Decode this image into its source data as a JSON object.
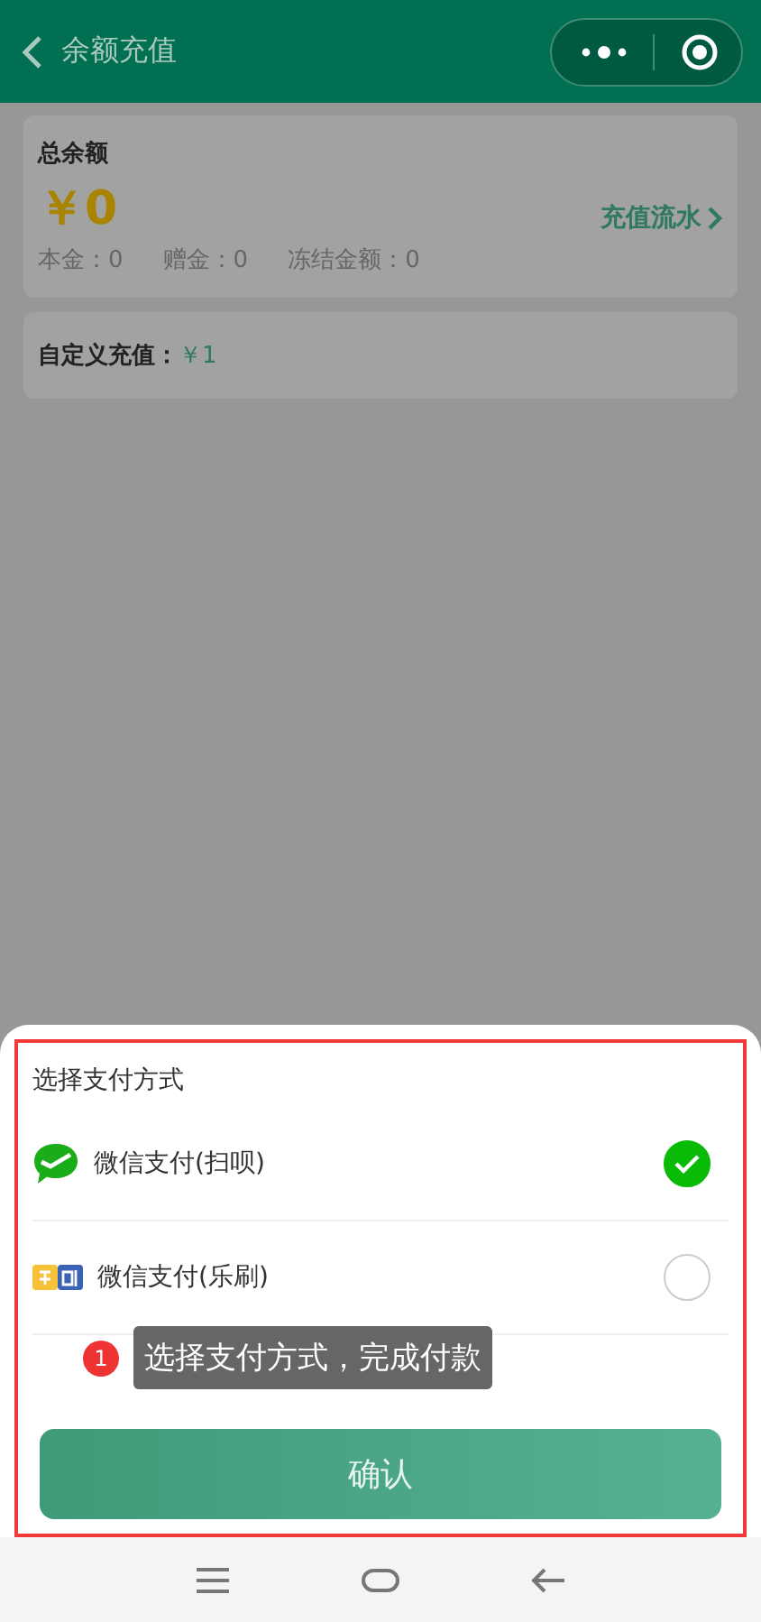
{
  "header": {
    "title": "余额充值"
  },
  "balance_card": {
    "label": "总余额",
    "amount": "￥0",
    "history_link": "充值流水",
    "details": [
      {
        "label": "本金：",
        "value": "0"
      },
      {
        "label": "赠金：",
        "value": "0"
      },
      {
        "label": "冻结金额：",
        "value": "0"
      }
    ]
  },
  "custom_card": {
    "label": "自定义充值：",
    "value": "￥1"
  },
  "payment_sheet": {
    "title": "选择支付方式",
    "methods": [
      {
        "kind": "wechat",
        "label": "微信支付(扫呗)",
        "selected": true
      },
      {
        "kind": "leshua",
        "label": "微信支付(乐刷)",
        "selected": false
      }
    ],
    "confirm_button": "确认"
  },
  "annotation": {
    "number": "1",
    "text": "选择支付方式，完成付款"
  }
}
